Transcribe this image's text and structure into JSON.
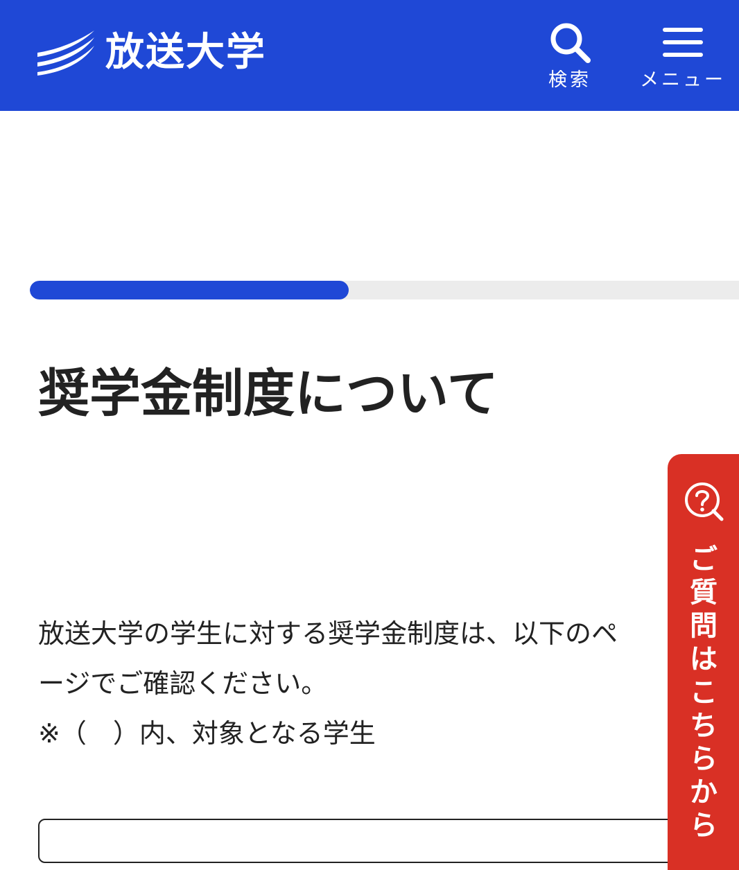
{
  "header": {
    "logo_text": "放送大学",
    "search_label": "検索",
    "menu_label": "メニュー",
    "background_color": "#1f48d6"
  },
  "progress": {
    "fraction": 0.45,
    "fill_color": "#1f48d6"
  },
  "main": {
    "title": "奨学金制度について",
    "intro_lines": [
      "放送大学の学生に対する奨学金制度は、以下のペ",
      "ージでご確認ください。",
      "※（　）内、対象となる学生"
    ]
  },
  "faq_tab": {
    "label": "ご質問はこちらから",
    "background_color": "#d93025",
    "icon": "question-circle-icon"
  }
}
